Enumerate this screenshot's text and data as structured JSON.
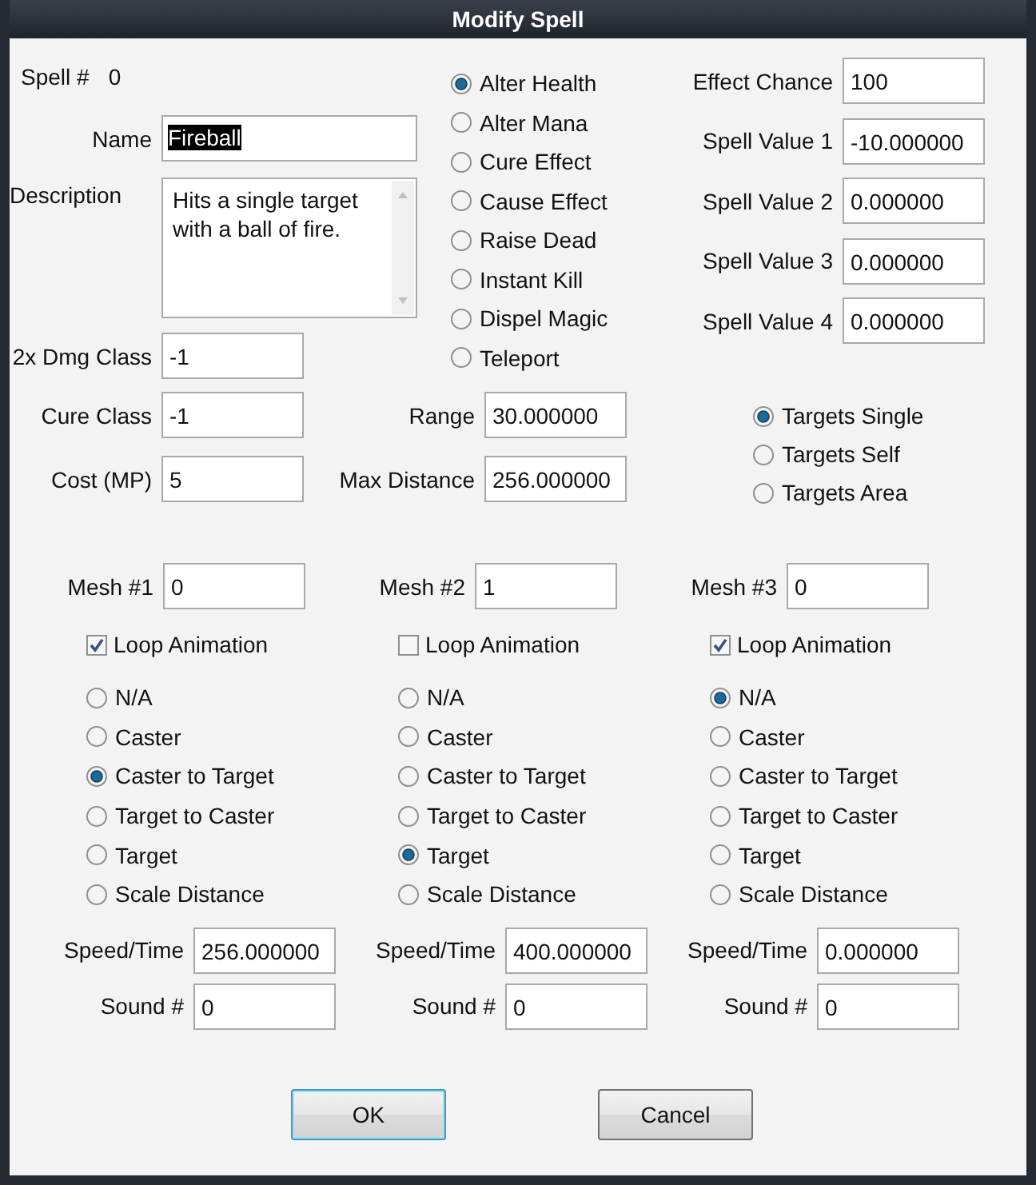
{
  "window": {
    "title": "Modify Spell"
  },
  "spell_number": {
    "label": "Spell #",
    "value": "0"
  },
  "name": {
    "label": "Name",
    "value": "Fireball",
    "text_selected": true
  },
  "description": {
    "label": "Description",
    "value": "Hits a single target with a ball of fire."
  },
  "dmg_class": {
    "label": "2x Dmg Class",
    "value": "-1"
  },
  "effect_types": [
    {
      "label": "Alter Health",
      "selected": true
    },
    {
      "label": "Alter Mana",
      "selected": false
    },
    {
      "label": "Cure Effect",
      "selected": false
    },
    {
      "label": "Cause Effect",
      "selected": false
    },
    {
      "label": "Raise Dead",
      "selected": false
    },
    {
      "label": "Instant Kill",
      "selected": false
    },
    {
      "label": "Dispel Magic",
      "selected": false
    },
    {
      "label": "Teleport",
      "selected": false
    }
  ],
  "effect_fields": [
    {
      "label": "Effect Chance",
      "value": "100"
    },
    {
      "label": "Spell Value 1",
      "value": "-10.000000"
    },
    {
      "label": "Spell Value 2",
      "value": "0.000000"
    },
    {
      "label": "Spell Value 3",
      "value": "0.000000"
    },
    {
      "label": "Spell Value 4",
      "value": "0.000000"
    }
  ],
  "cure_class": {
    "label": "Cure Class",
    "value": "-1"
  },
  "cost": {
    "label": "Cost (MP)",
    "value": "5"
  },
  "range": {
    "label": "Range",
    "value": "30.000000"
  },
  "max_distance": {
    "label": "Max Distance",
    "value": "256.000000"
  },
  "target_modes": [
    {
      "label": "Targets Single",
      "selected": true
    },
    {
      "label": "Targets Self",
      "selected": false
    },
    {
      "label": "Targets Area",
      "selected": false
    }
  ],
  "meshes": [
    {
      "mesh": {
        "label": "Mesh #1",
        "value": "0"
      },
      "loop": {
        "label": "Loop Animation",
        "checked": true
      },
      "paths": [
        {
          "label": "N/A",
          "selected": false
        },
        {
          "label": "Caster",
          "selected": false
        },
        {
          "label": "Caster to Target",
          "selected": true
        },
        {
          "label": "Target to Caster",
          "selected": false
        },
        {
          "label": "Target",
          "selected": false
        },
        {
          "label": "Scale Distance",
          "selected": false
        }
      ],
      "speed": {
        "label": "Speed/Time",
        "value": "256.000000"
      },
      "sound": {
        "label": "Sound #",
        "value": "0"
      }
    },
    {
      "mesh": {
        "label": "Mesh #2",
        "value": "1"
      },
      "loop": {
        "label": "Loop Animation",
        "checked": false
      },
      "paths": [
        {
          "label": "N/A",
          "selected": false
        },
        {
          "label": "Caster",
          "selected": false
        },
        {
          "label": "Caster to Target",
          "selected": false
        },
        {
          "label": "Target to Caster",
          "selected": false
        },
        {
          "label": "Target",
          "selected": true
        },
        {
          "label": "Scale Distance",
          "selected": false
        }
      ],
      "speed": {
        "label": "Speed/Time",
        "value": "400.000000"
      },
      "sound": {
        "label": "Sound #",
        "value": "0"
      }
    },
    {
      "mesh": {
        "label": "Mesh #3",
        "value": "0"
      },
      "loop": {
        "label": "Loop Animation",
        "checked": true
      },
      "paths": [
        {
          "label": "N/A",
          "selected": true
        },
        {
          "label": "Caster",
          "selected": false
        },
        {
          "label": "Caster to Target",
          "selected": false
        },
        {
          "label": "Target to Caster",
          "selected": false
        },
        {
          "label": "Target",
          "selected": false
        },
        {
          "label": "Scale Distance",
          "selected": false
        }
      ],
      "speed": {
        "label": "Speed/Time",
        "value": "0.000000"
      },
      "sound": {
        "label": "Sound #",
        "value": "0"
      }
    }
  ],
  "buttons": [
    {
      "label": "OK",
      "default": true
    },
    {
      "label": "Cancel",
      "default": false
    }
  ]
}
